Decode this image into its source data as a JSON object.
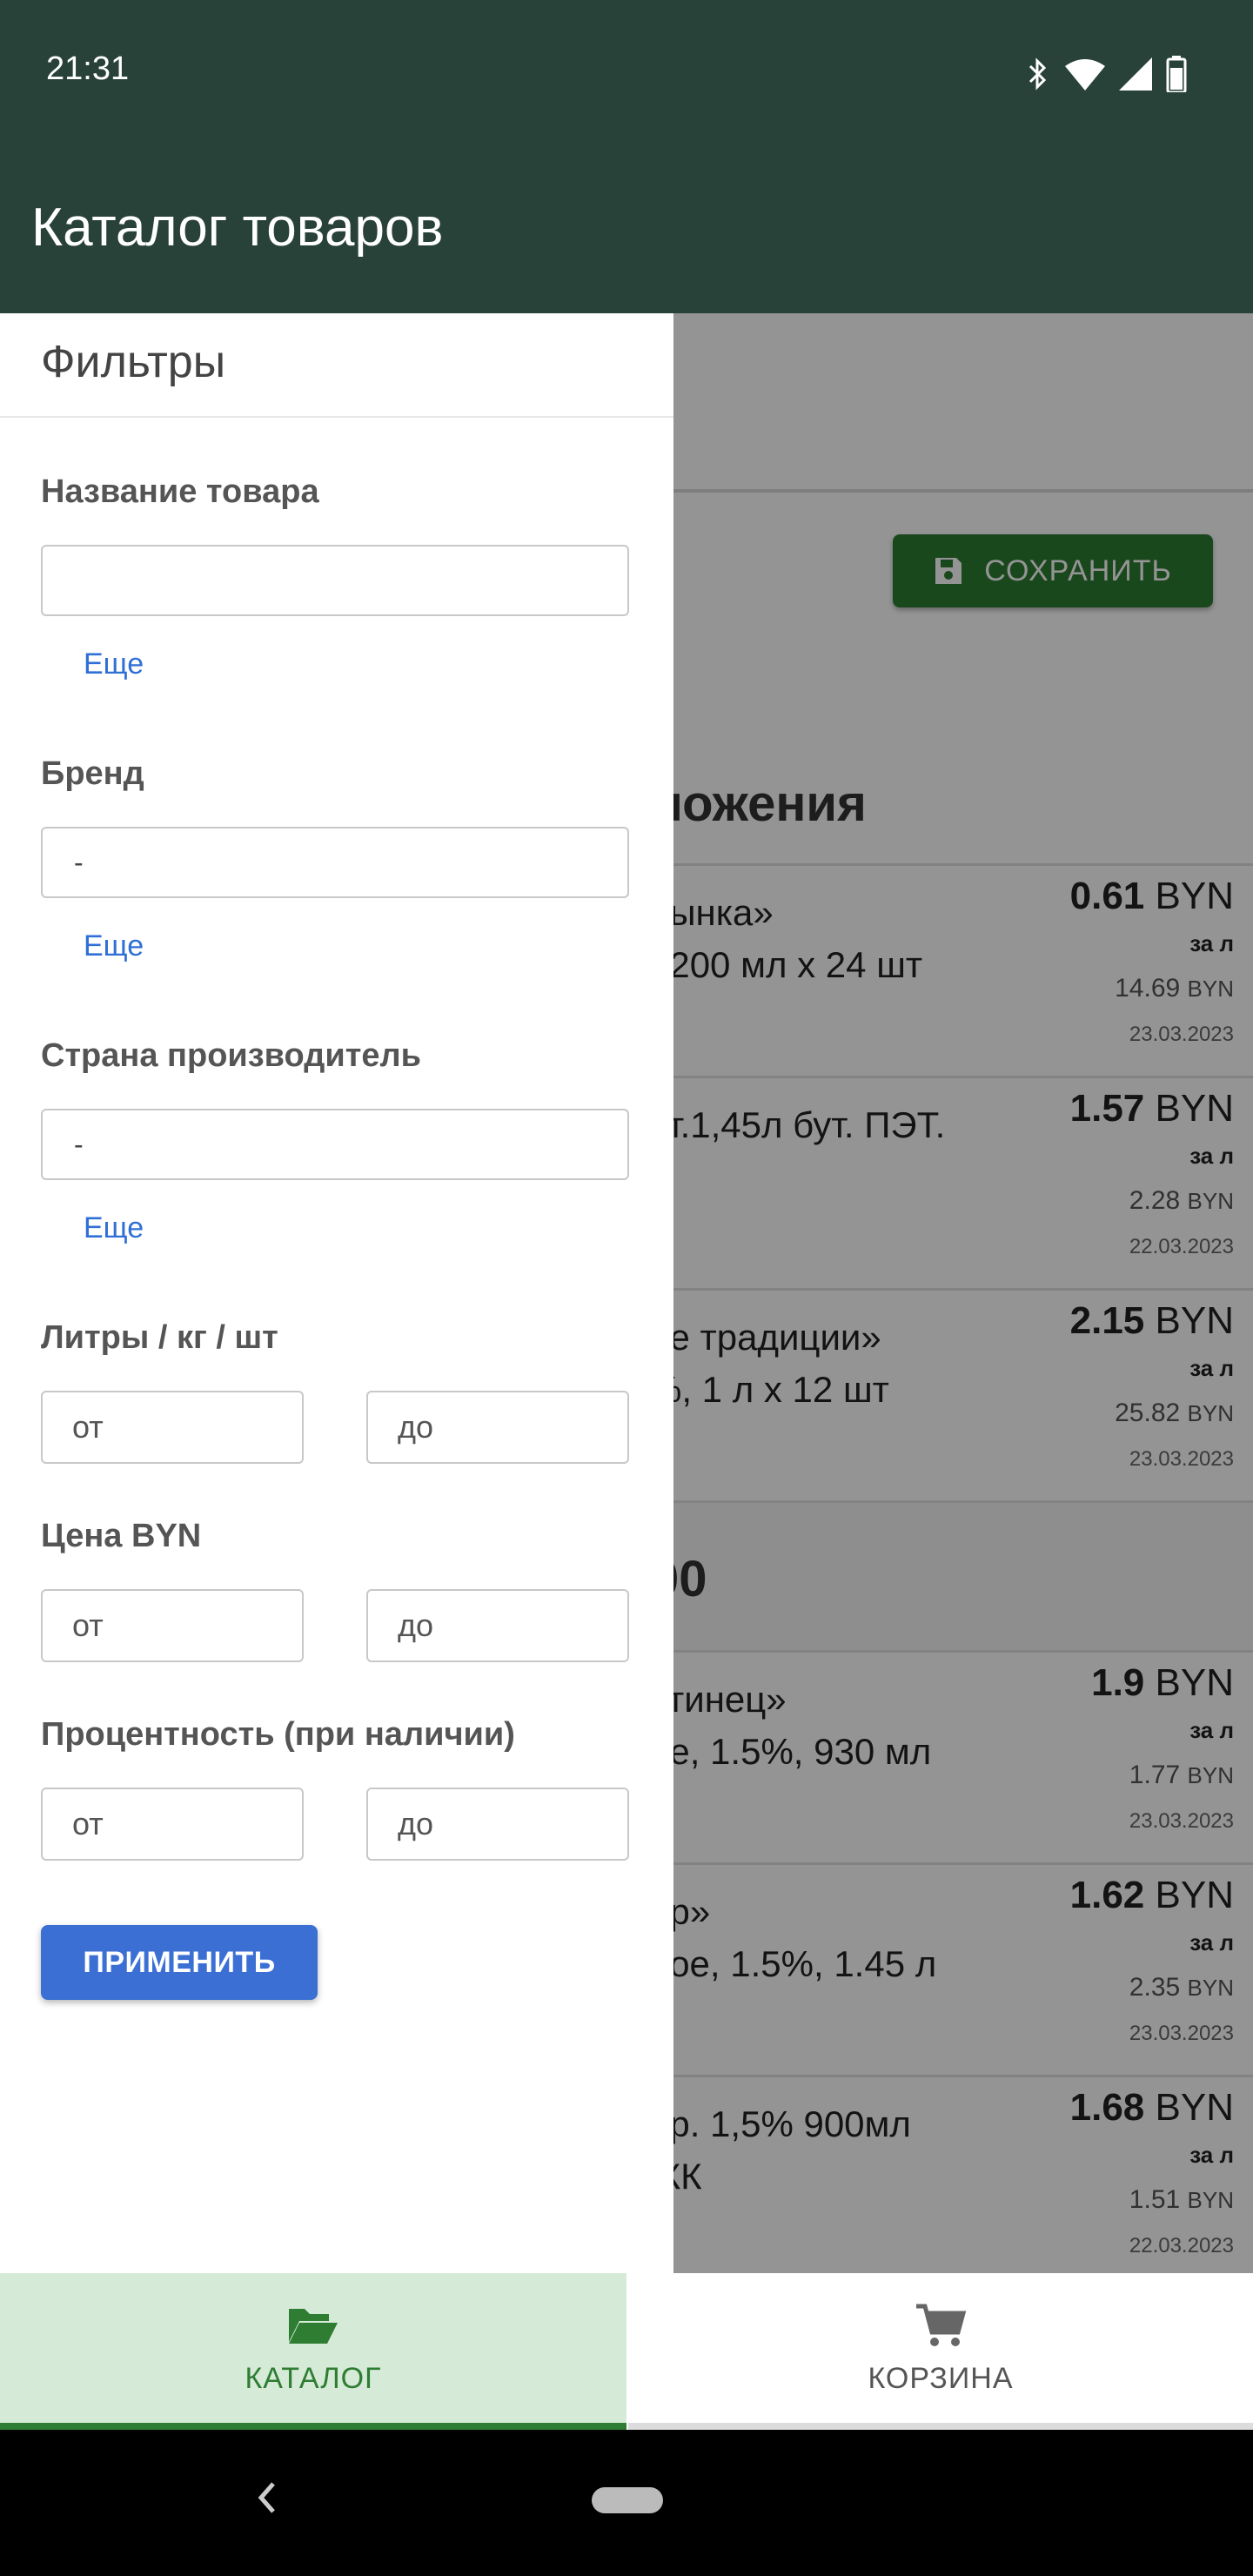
{
  "status_bar": {
    "time": "21:31",
    "icons": [
      "bluetooth-icon",
      "wifi-icon",
      "signal-icon",
      "battery-icon"
    ]
  },
  "app_bar": {
    "title": "Каталог товаров"
  },
  "background": {
    "save_button": {
      "label": "СОХРАНИТЬ",
      "icon": "save-icon"
    },
    "section_1_title": "ложения",
    "section_2_title": "00",
    "products": [
      {
        "name": "рынка»\n. 200 мл х 24 шт",
        "price": "0.61",
        "currency": "BYN",
        "per": "за л",
        "old_price": "14.69",
        "old_currency": "BYN",
        "date": "23.03.2023"
      },
      {
        "name": "ст.1,45л бут. ПЭТ.",
        "price": "1.57",
        "currency": "BYN",
        "per": "за л",
        "old_price": "2.28",
        "old_currency": "BYN",
        "date": "22.03.2023"
      },
      {
        "name": "ие традиции»\n%, 1 л х 12 шт",
        "price": "2.15",
        "currency": "BYN",
        "per": "за л",
        "old_price": "25.82",
        "old_currency": "BYN",
        "date": "23.03.2023"
      },
      {
        "name": "стинец»\nре, 1.5%, 930 мл",
        "price": "1.9",
        "currency": "BYN",
        "per": "за л",
        "old_price": "1.77",
        "old_currency": "BYN",
        "date": "23.03.2023"
      },
      {
        "name": "ир»\nное, 1.5%, 1.45 л",
        "price": "1.62",
        "currency": "BYN",
        "per": "за л",
        "old_price": "2.35",
        "old_currency": "BYN",
        "date": "23.03.2023"
      },
      {
        "name": "ер. 1,5% 900мл\nIКК",
        "price": "1.68",
        "currency": "BYN",
        "per": "за л",
        "old_price": "1.51",
        "old_currency": "BYN",
        "date": "22.03.2023"
      }
    ]
  },
  "filters": {
    "title": "Фильтры",
    "name_label": "Название товара",
    "name_value": "",
    "more_1": "Еще",
    "brand_label": "Бренд",
    "brand_value": "-",
    "more_2": "Еще",
    "country_label": "Страна производитель",
    "country_value": "-",
    "more_3": "Еще",
    "volume_label": "Литры / кг / шт",
    "price_label": "Цена BYN",
    "percent_label": "Процентность (при наличии)",
    "from_placeholder": "от",
    "to_placeholder": "до",
    "apply_label": "ПРИМЕНИТЬ"
  },
  "bottom_nav": {
    "tabs": [
      {
        "label": "КАТАЛОГ",
        "icon": "folder-open-icon",
        "active": true
      },
      {
        "label": "КОРЗИНА",
        "icon": "cart-icon",
        "active": false
      }
    ]
  },
  "colors": {
    "app_bar": "#28423a",
    "accent_green": "#2e7d32",
    "apply_blue": "#3b6fd3",
    "link_blue": "#2f6fd6"
  }
}
